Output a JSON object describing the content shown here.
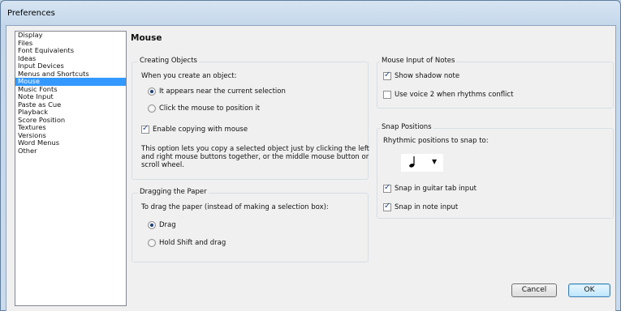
{
  "window": {
    "title": "Preferences"
  },
  "sidebar": {
    "items": [
      {
        "label": "Display"
      },
      {
        "label": "Files"
      },
      {
        "label": "Font Equivalents"
      },
      {
        "label": "Ideas"
      },
      {
        "label": "Input Devices"
      },
      {
        "label": "Menus and Shortcuts"
      },
      {
        "label": "Mouse",
        "selected": true
      },
      {
        "label": "Music Fonts"
      },
      {
        "label": "Note Input"
      },
      {
        "label": "Paste as Cue"
      },
      {
        "label": "Playback"
      },
      {
        "label": "Score Position"
      },
      {
        "label": "Textures"
      },
      {
        "label": "Versions"
      },
      {
        "label": "Word Menus"
      },
      {
        "label": "Other"
      }
    ]
  },
  "page": {
    "heading": "Mouse"
  },
  "creating_objects": {
    "title": "Creating Objects",
    "prompt": "When you create an object:",
    "option_near_selection": "It appears near the current selection",
    "option_near_selection_checked": true,
    "option_click_mouse": "Click the mouse to position it",
    "option_click_mouse_checked": false,
    "enable_copying": "Enable copying with mouse",
    "enable_copying_checked": true,
    "help_text": "This option lets you copy a selected object just by clicking the left and right mouse buttons together, or the middle mouse button or scroll wheel."
  },
  "dragging_paper": {
    "title": "Dragging the Paper",
    "prompt": "To drag the paper (instead of making a selection box):",
    "option_drag": "Drag",
    "option_drag_checked": true,
    "option_shift_drag": "Hold Shift and drag",
    "option_shift_drag_checked": false
  },
  "mouse_input": {
    "title": "Mouse Input of Notes",
    "show_shadow": "Show shadow note",
    "show_shadow_checked": true,
    "use_voice2": "Use voice 2 when rhythms conflict",
    "use_voice2_checked": false
  },
  "snap_positions": {
    "title": "Snap Positions",
    "rhythmic_label": "Rhythmic positions to snap to:",
    "rhythm_value_icon": "quarter-note-icon",
    "snap_guitar": "Snap in guitar tab input",
    "snap_guitar_checked": true,
    "snap_note": "Snap in note input",
    "snap_note_checked": true
  },
  "buttons": {
    "cancel": "Cancel",
    "ok": "OK"
  }
}
